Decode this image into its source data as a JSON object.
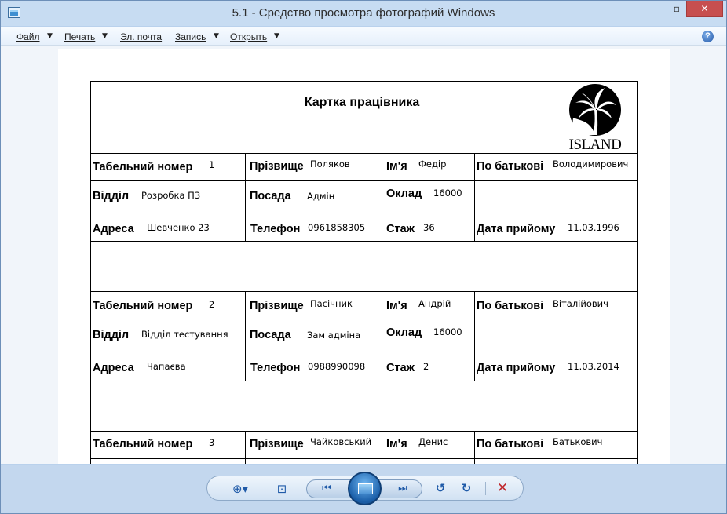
{
  "window": {
    "title": "5.1 - Средство просмотра фотографий Windows"
  },
  "title_buttons": {
    "minimize": "–",
    "maximize": "▫",
    "close": "✕"
  },
  "menu": [
    {
      "label": "Файл",
      "has_dropdown": true
    },
    {
      "label": "Печать",
      "has_dropdown": true
    },
    {
      "label": "Эл. почта",
      "has_dropdown": false
    },
    {
      "label": "Запись",
      "has_dropdown": true
    },
    {
      "label": "Открыть",
      "has_dropdown": true
    }
  ],
  "menu_arrow": "▼",
  "help": "?",
  "document": {
    "title": "Картка працівника",
    "logo_text": "ISLAND",
    "labels": {
      "tab": "Табельний номер",
      "surname": "Прізвище",
      "name": "Ім'я",
      "patronymic": "По батькові",
      "dept": "Відділ",
      "position": "Посада",
      "salary": "Оклад",
      "address": "Адреса",
      "phone": "Телефон",
      "stage": "Стаж",
      "hired": "Дата прийому"
    },
    "employees": [
      {
        "tab": "1",
        "surname": "Поляков",
        "name": "Федір",
        "patronymic": "Володимирович",
        "dept": "Розробка ПЗ",
        "position": "Адмін",
        "salary": "16000",
        "address": "Шевченко 23",
        "phone": "0961858305",
        "stage": "36",
        "hired": "11.03.1996"
      },
      {
        "tab": "2",
        "surname": "Пасічник",
        "name": "Андрій",
        "patronymic": "Віталійович",
        "dept": "Відділ тестування",
        "position": "Зам адміна",
        "salary": "16000",
        "address": "Чапаєва",
        "phone": "0988990098",
        "stage": "2",
        "hired": "11.03.2014"
      },
      {
        "tab": "3",
        "surname": "Чайковський",
        "name": "Денис",
        "patronymic": "Батькович"
      }
    ]
  },
  "toolbar": {
    "zoom": "⊕▾",
    "fit": "⊡",
    "prev": "⏮",
    "next": "⏭",
    "rotate_left": "↺",
    "rotate_right": "↻",
    "delete": "✕"
  },
  "colors": {
    "close_button": "#c74f4f",
    "toolbar_accent": "#1a5ea8",
    "delete": "#c0282d"
  }
}
